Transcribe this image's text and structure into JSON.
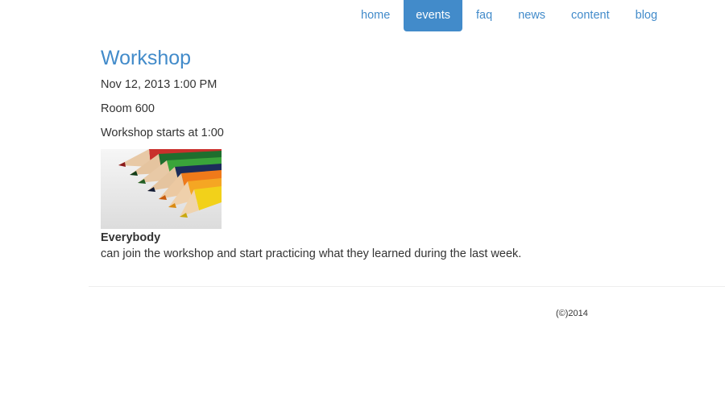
{
  "nav": {
    "items": [
      {
        "label": "home",
        "active": false
      },
      {
        "label": "events",
        "active": true
      },
      {
        "label": "faq",
        "active": false
      },
      {
        "label": "news",
        "active": false
      },
      {
        "label": "content",
        "active": false
      },
      {
        "label": "blog",
        "active": false
      }
    ]
  },
  "event": {
    "title": "Workshop",
    "datetime": "Nov 12, 2013 1:00 PM",
    "location": "Room 600",
    "start_note": "Workshop starts at 1:00",
    "image_icon": "colored-pencils-photo",
    "audience": "Everybody",
    "description": "can join the workshop and start practicing what they learned during the last week."
  },
  "footer": {
    "copyright": "(©)2014"
  },
  "colors": {
    "accent": "#428bca",
    "text": "#333333",
    "divider": "#eeeeee"
  }
}
